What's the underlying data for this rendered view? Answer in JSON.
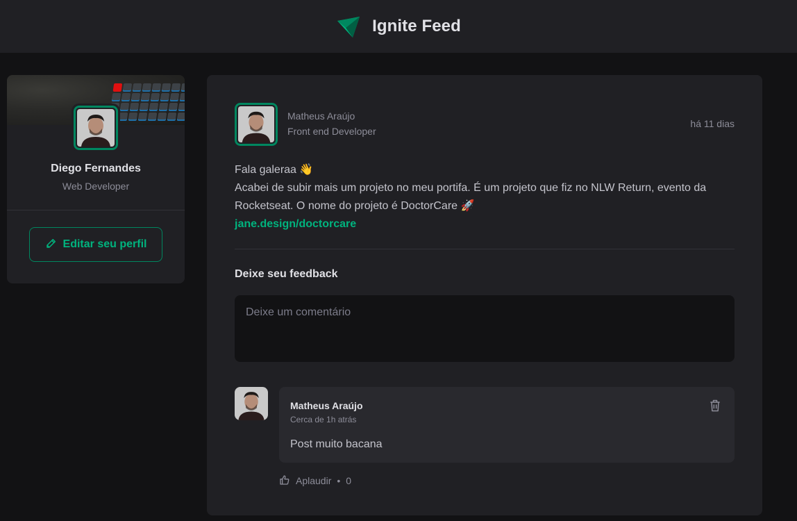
{
  "header": {
    "title": "Ignite Feed",
    "logo_icon": "paper-plane-logo-icon"
  },
  "sidebar": {
    "name": "Diego Fernandes",
    "role": "Web Developer",
    "edit_label": "Editar seu perfil",
    "edit_icon": "pencil-icon"
  },
  "post": {
    "author_name": "Matheus Araújo",
    "author_role": "Front end Developer",
    "time": "há 11 dias",
    "paragraphs": [
      "Fala galeraa 👋",
      "Acabei de subir mais um projeto no meu portifa. É um projeto que fiz no NLW Return, evento da Rocketseat. O nome do projeto é DoctorCare 🚀"
    ],
    "link": "jane.design/doctorcare"
  },
  "feedback": {
    "title": "Deixe seu feedback",
    "placeholder": "Deixe um comentário"
  },
  "comment": {
    "author": "Matheus Araújo",
    "time": "Cerca de 1h atrás",
    "text": "Post muito bacana",
    "applaud_label": "Aplaudir",
    "applaud_separator": "•",
    "applaud_count": "0"
  },
  "colors": {
    "brand": "#00875f",
    "brand_light": "#00b37e",
    "bg": "#121214",
    "card": "#202024"
  }
}
